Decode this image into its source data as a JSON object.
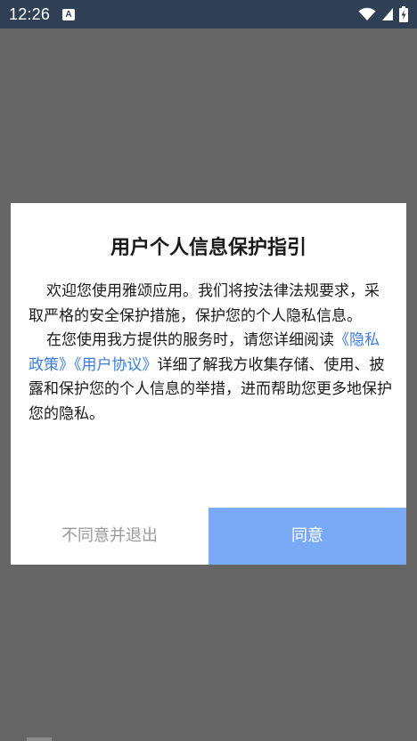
{
  "status_bar": {
    "time": "12:26",
    "notification_letter": "A",
    "icons": [
      "wifi-icon",
      "signal-icon",
      "battery-charging-icon"
    ],
    "background_color": "#2f4054"
  },
  "dialog": {
    "title": "用户个人信息保护指引",
    "paragraph1": "欢迎您使用雅颂应用。我们将按法律法规要求，采取严格的安全保护措施，保护您的个人隐私信息。",
    "paragraph2_prefix": "在您使用我方提供的服务时，请您详细阅读",
    "privacy_policy_link": "《隐私政策》",
    "user_agreement_link": "《用户协议》",
    "paragraph2_suffix": "详细了解我方收集存储、使用、披露和保护您的个人信息的举措，进而帮助您更多地保护您的隐私。",
    "decline_label": "不同意并退出",
    "agree_label": "同意",
    "accent_color": "#7aaaf6",
    "link_color": "#3b7ddd"
  }
}
